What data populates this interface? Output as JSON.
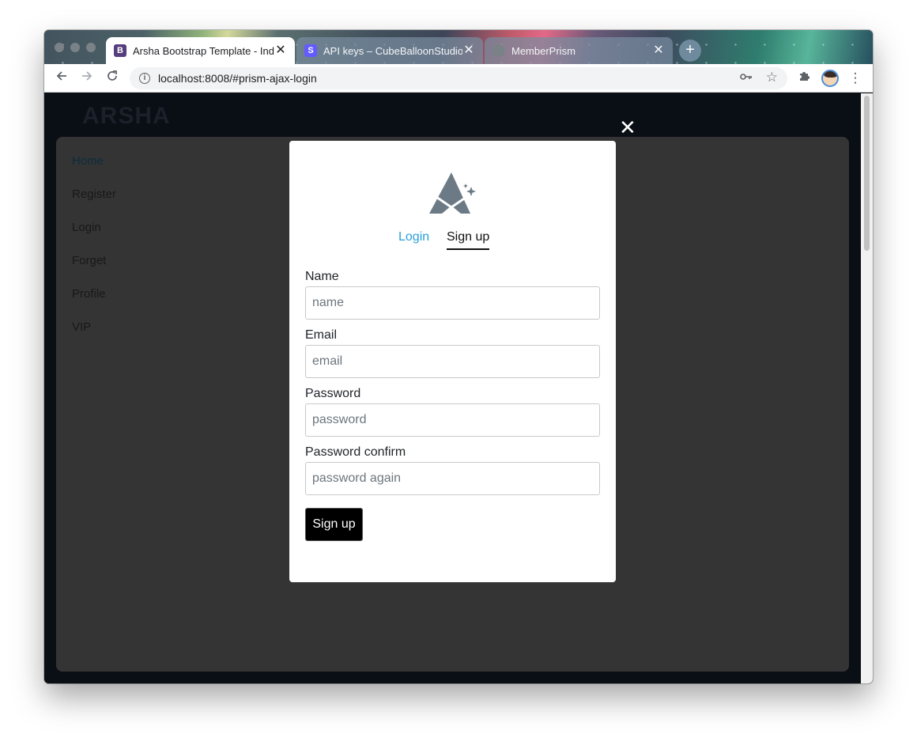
{
  "browser": {
    "tabs": [
      {
        "title": "Arsha Bootstrap Template - Index",
        "favicon_letter": "B",
        "favicon_color": "#563d7c",
        "active": true,
        "close": "✕"
      },
      {
        "title": "API keys – CubeBalloonStudio",
        "favicon_letter": "S",
        "favicon_color": "#635bff",
        "active": false,
        "close": "✕"
      },
      {
        "title": "MemberPrism",
        "favicon_letter": "",
        "favicon_color": "#7a8288",
        "active": false,
        "close": "✕"
      }
    ],
    "new_tab": "+",
    "url": "localhost:8008/#prism-ajax-login",
    "icons": {
      "back": "arrow-left-icon",
      "forward": "arrow-right-icon",
      "reload": "reload-icon",
      "info": "info-icon",
      "key": "key-icon",
      "star": "star-icon",
      "extensions": "puzzle-icon",
      "menu": "kebab-menu-icon"
    }
  },
  "page": {
    "brand": "ARSHA",
    "nav": [
      "Home",
      "Register",
      "Login",
      "Forget",
      "Profile",
      "VIP"
    ],
    "close_symbol": "✕"
  },
  "modal": {
    "tabs": {
      "login": "Login",
      "signup": "Sign up"
    },
    "fields": {
      "name": {
        "label": "Name",
        "placeholder": "name"
      },
      "email": {
        "label": "Email",
        "placeholder": "email"
      },
      "password": {
        "label": "Password",
        "placeholder": "password"
      },
      "password_confirm": {
        "label": "Password confirm",
        "placeholder": "password again"
      }
    },
    "submit_label": "Sign up"
  },
  "colors": {
    "accent": "#2a9fd8",
    "button": "#000000",
    "logo": "#6b7a85"
  }
}
